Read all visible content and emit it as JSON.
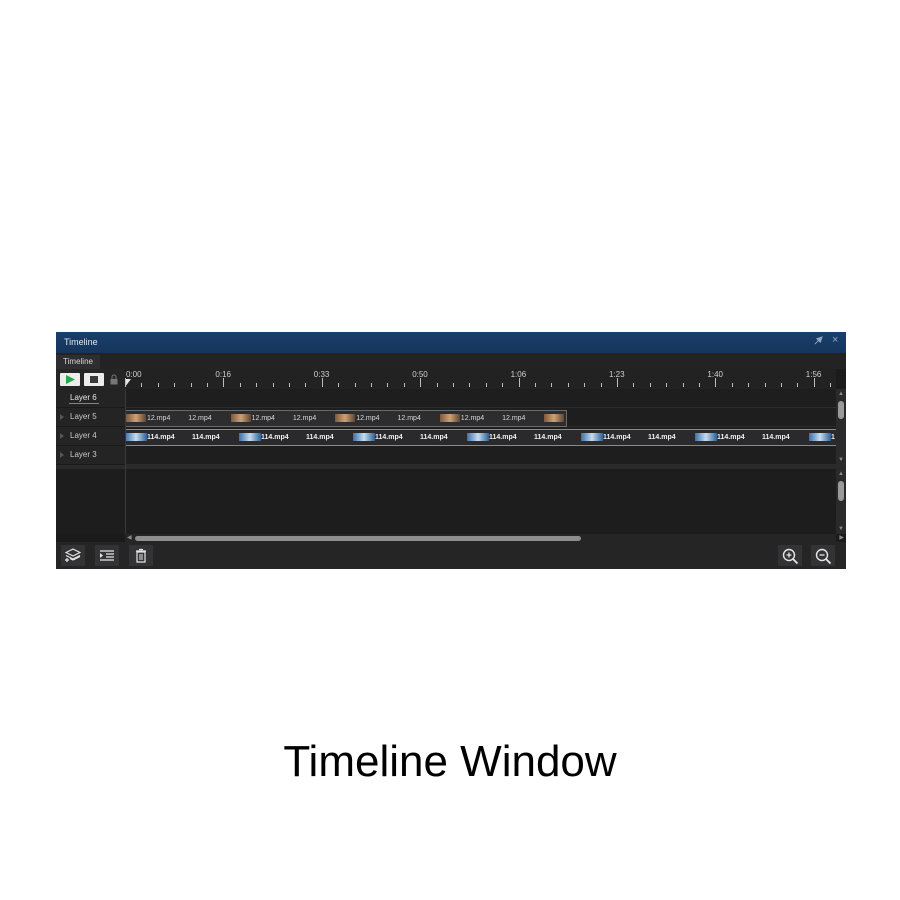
{
  "window": {
    "title": "Timeline",
    "tab": "Timeline",
    "pin_icon": "pin-icon",
    "close_glyph": "×"
  },
  "ruler": {
    "labels": [
      "0:00",
      "0:16",
      "0:33",
      "0:50",
      "1:06",
      "1:23",
      "1:40",
      "1:56"
    ]
  },
  "layers": [
    {
      "name": "Layer 6"
    },
    {
      "name": "Layer 5"
    },
    {
      "name": "Layer 4"
    },
    {
      "name": "Layer 3"
    }
  ],
  "tracks": {
    "layer5_clips": [
      "12.mp4",
      "12.mp4",
      "12.mp4",
      "12.mp4",
      "12.mp4",
      "12.mp4",
      "12.mp4",
      "12.mp4"
    ],
    "layer4_clips": [
      "114.mp4",
      "114.mp4",
      "114.mp4",
      "114.mp4",
      "114.mp4",
      "114.mp4",
      "114.mp4",
      "114.mp4",
      "114.mp4",
      "114.mp4",
      "114.mp4",
      "114.mp4",
      "1"
    ]
  },
  "buttons": {
    "play": "play-icon",
    "stop": "stop-icon",
    "lock": "lock-icon",
    "add_layer": "add-layer-icon",
    "indent": "indent-icon",
    "delete": "trash-icon",
    "zoom_in": "zoom-in-icon",
    "zoom_out": "zoom-out-icon"
  },
  "colors": {
    "titlebar": "#15355c",
    "accent": "#2b9ff0",
    "play": "#2aa64a"
  },
  "caption": "Timeline Window"
}
